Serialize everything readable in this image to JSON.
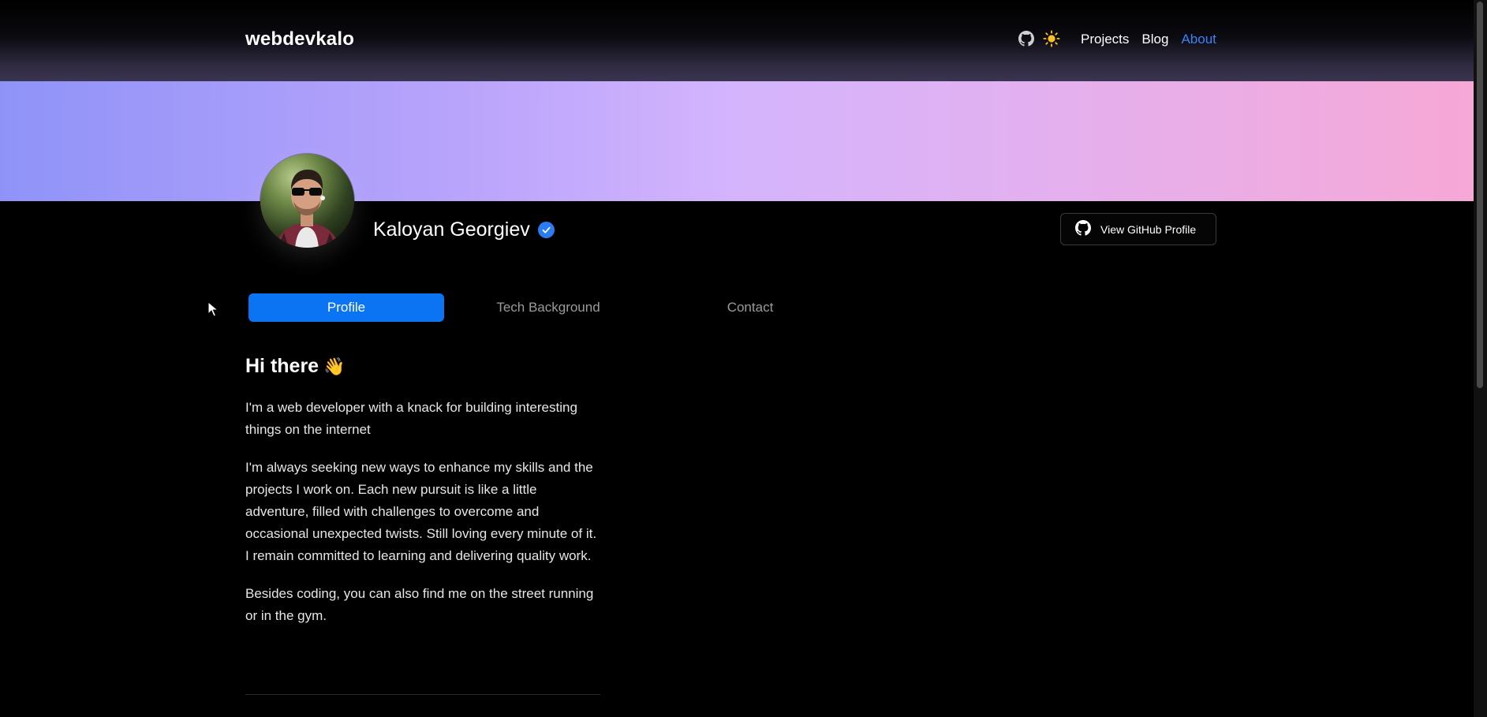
{
  "header": {
    "brand": "webdevkalo",
    "nav": [
      {
        "label": "Projects",
        "active": false
      },
      {
        "label": "Blog",
        "active": false
      },
      {
        "label": "About",
        "active": true
      }
    ],
    "icons": [
      "github-icon",
      "sun-icon"
    ]
  },
  "profile": {
    "name": "Kaloyan Georgiev",
    "verified": true,
    "github_button_label": "View GitHub Profile"
  },
  "tabs": [
    {
      "label": "Profile",
      "active": true
    },
    {
      "label": "Tech Background",
      "active": false
    },
    {
      "label": "Contact",
      "active": false
    }
  ],
  "content": {
    "heading": "Hi there",
    "heading_emoji": "👋",
    "paragraphs": [
      "I'm a web developer with a knack for building interesting things on the internet",
      "I'm always seeking new ways to enhance my skills and the projects I work on. Each new pursuit is like a little adventure, filled with challenges to overcome and occasional unexpected twists. Still loving every minute of it. I remain committed to learning and delivering quality work.",
      "Besides coding, you can also find me on the street running or in the gym."
    ]
  },
  "colors": {
    "accent": "#0a74f2",
    "nav_active": "#3b82f6",
    "banner_start": "#8f93f8",
    "banner_end": "#f6a8d6"
  }
}
